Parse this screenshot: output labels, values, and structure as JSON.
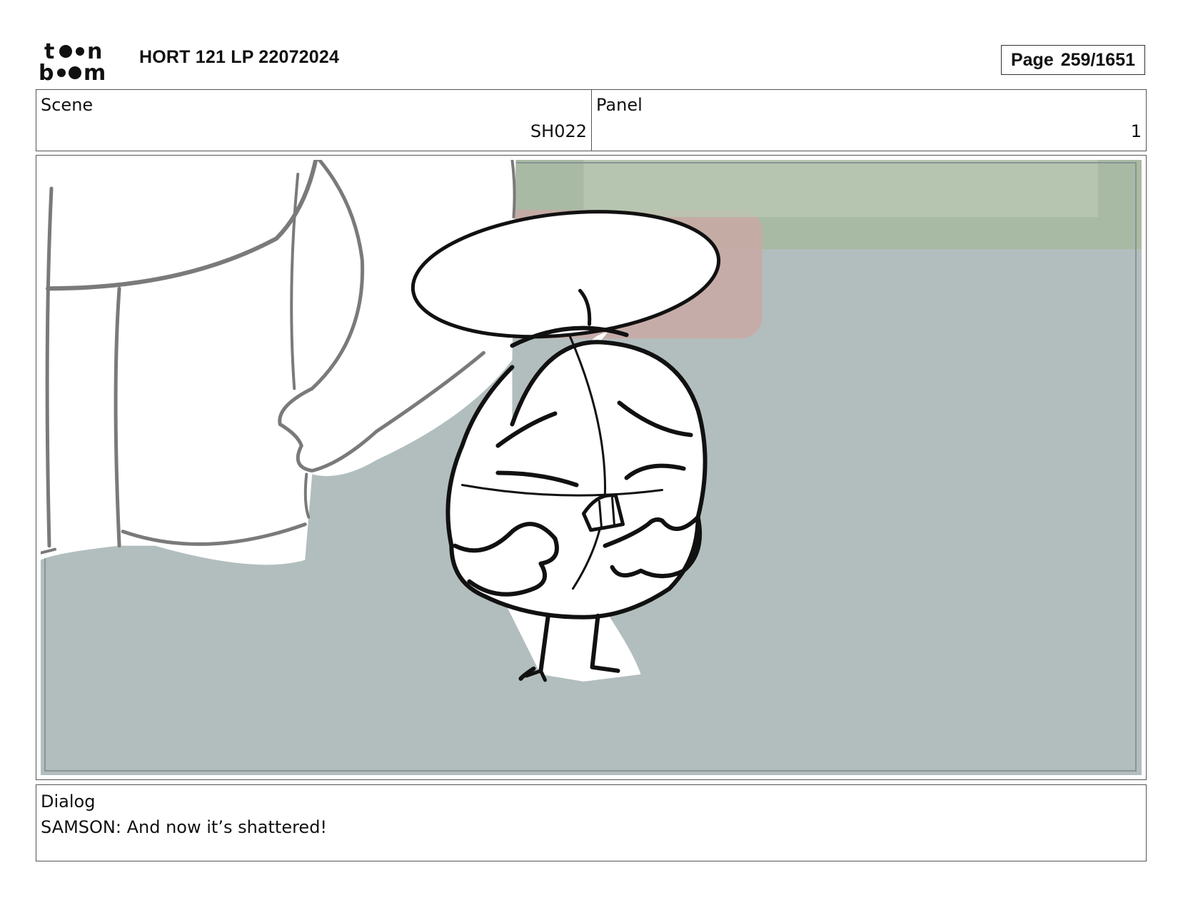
{
  "header": {
    "logo_name": "toon-boom-logo",
    "document_title": "HORT 121 LP 22072024",
    "page_label": "Page",
    "page_number": "259/1651"
  },
  "scene": {
    "label": "Scene",
    "value": "SH022"
  },
  "panel": {
    "label": "Panel",
    "value": "1"
  },
  "dialog": {
    "label": "Dialog",
    "text": "SAMSON: And now it’s shattered!"
  },
  "colors": {
    "floor": "#b2bebe",
    "wall_green": "#a9baa4",
    "couch_pink": "#c9a9a5",
    "line": "#111111",
    "sketch_grey": "#7a7a7a"
  }
}
